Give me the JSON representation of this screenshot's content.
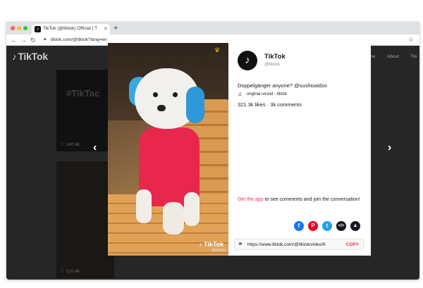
{
  "browser": {
    "tab_title": "TikTok (@tiktok) Official | T",
    "tab_close": "×",
    "new_tab": "+",
    "back": "←",
    "forward": "→",
    "reload": "↻",
    "url": "tiktok.com/@tiktok?lang=en",
    "bookmark": "☆"
  },
  "site": {
    "logo": "TikTok",
    "nav": [
      "Home",
      "About",
      "Tre"
    ]
  },
  "background_videos": [
    {
      "overlay_text": "#TikTac",
      "likes": "140.4k"
    },
    {
      "overlay_text": "",
      "likes": "125.4k"
    }
  ],
  "modal": {
    "prev_arrow": "‹",
    "next_arrow": "›",
    "watermark": "TikTok",
    "watermark_handle": "@tiktok",
    "account_name": "TikTok",
    "account_handle": "@tiktok",
    "caption": "Doppelgänger anyone? @sushisaidso",
    "sound": "original sound - tiktok",
    "stats": "321.3k likes · 3k comments",
    "cta_link": "Get the app",
    "cta_text": " to see comments and join the conversation!",
    "share_url": "https://www.tiktok.com/@tiktok/video/6",
    "copy_label": "COPY"
  },
  "colors": {
    "accent": "#fe2c55",
    "facebook": "#1877f2",
    "pinterest": "#e60023",
    "twitter": "#1da1f2"
  },
  "icons": [
    "tiktok-logo-icon",
    "lock-icon",
    "star-icon",
    "heart-icon",
    "crown-icon",
    "music-note-icon",
    "facebook-icon",
    "pinterest-icon",
    "twitter-icon",
    "embed-icon",
    "more-icon",
    "link-icon"
  ]
}
